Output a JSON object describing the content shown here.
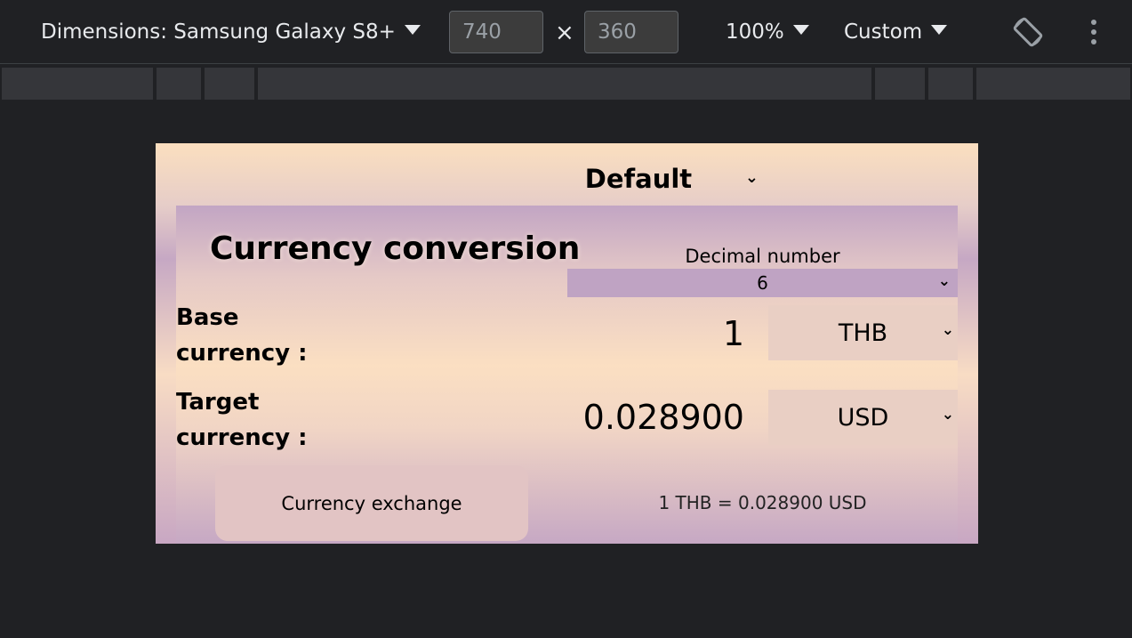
{
  "devtools": {
    "dimensions_label": "Dimensions: Samsung Galaxy S8+",
    "width": "740",
    "height": "360",
    "times": "×",
    "zoom": "100%",
    "throttle": "Custom",
    "rotate_icon": "rotate-icon",
    "more_icon": "more-vert-icon",
    "accent": "#202124"
  },
  "app": {
    "theme_value": "Default",
    "title": "Currency conversion",
    "decimal": {
      "label": "Decimal number",
      "value": "6"
    },
    "base": {
      "label_line1": "Base",
      "label_line2": "currency :",
      "amount": "1",
      "currency": "THB"
    },
    "target": {
      "label_line1": "Target",
      "label_line2": "currency :",
      "amount": "0.028900",
      "currency": "USD"
    },
    "exchange_button": "Currency exchange",
    "result": "1 THB = 0.028900 USD",
    "colors": {
      "peach": "#fbdfbf",
      "lavender": "#c2a5c4"
    }
  }
}
